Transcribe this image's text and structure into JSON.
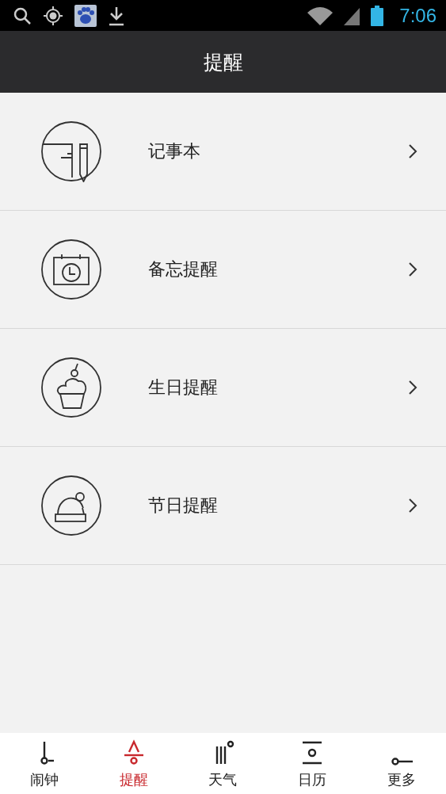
{
  "status_bar": {
    "time": "7:06"
  },
  "header": {
    "title": "提醒"
  },
  "items": [
    {
      "kind": "notepad",
      "label": "记事本"
    },
    {
      "kind": "memo",
      "label": "备忘提醒"
    },
    {
      "kind": "birthday",
      "label": "生日提醒"
    },
    {
      "kind": "holiday",
      "label": "节日提醒"
    }
  ],
  "tabs": [
    {
      "kind": "alarm",
      "label": "闹钟",
      "selected": false
    },
    {
      "kind": "reminder",
      "label": "提醒",
      "selected": true
    },
    {
      "kind": "weather",
      "label": "天气",
      "selected": false
    },
    {
      "kind": "calendar",
      "label": "日历",
      "selected": false
    },
    {
      "kind": "more",
      "label": "更多",
      "selected": false
    }
  ]
}
